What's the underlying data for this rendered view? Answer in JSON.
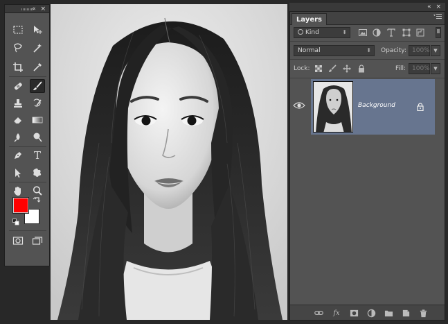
{
  "tools_panel": {
    "collapse_glyph": "«",
    "close_glyph": "×",
    "tools": [
      {
        "name": "rectangular-marquee-tool",
        "icon": "marquee-icon"
      },
      {
        "name": "move-tool",
        "icon": "move-icon"
      },
      {
        "name": "lasso-tool",
        "icon": "lasso-icon"
      },
      {
        "name": "magic-wand-tool",
        "icon": "magic-wand-icon"
      },
      {
        "name": "crop-tool",
        "icon": "crop-icon"
      },
      {
        "name": "eyedropper-tool",
        "icon": "eyedropper-icon"
      },
      {
        "name": "spot-healing-tool",
        "icon": "bandage-icon"
      },
      {
        "name": "brush-tool",
        "icon": "brush-icon",
        "active": true
      },
      {
        "name": "clone-stamp-tool",
        "icon": "stamp-icon"
      },
      {
        "name": "history-brush-tool",
        "icon": "history-brush-icon"
      },
      {
        "name": "eraser-tool",
        "icon": "eraser-icon"
      },
      {
        "name": "gradient-tool",
        "icon": "gradient-icon"
      },
      {
        "name": "blur-tool",
        "icon": "blur-icon"
      },
      {
        "name": "dodge-tool",
        "icon": "dodge-icon"
      },
      {
        "name": "pen-tool",
        "icon": "pen-icon"
      },
      {
        "name": "type-tool",
        "icon": "type-icon",
        "glyph": "T"
      },
      {
        "name": "path-selection-tool",
        "icon": "arrow-icon"
      },
      {
        "name": "custom-shape-tool",
        "icon": "shape-icon"
      },
      {
        "name": "hand-tool",
        "icon": "hand-icon"
      },
      {
        "name": "zoom-tool",
        "icon": "zoom-icon"
      }
    ],
    "foreground_color": "#ff0000",
    "background_color": "#ffffff"
  },
  "layers_panel": {
    "collapse_glyph": "«",
    "close_glyph": "×",
    "tab_label": "Layers",
    "filter_kind_label": "Kind",
    "blend_mode": "Normal",
    "opacity_label": "Opacity:",
    "opacity_value": "100%",
    "lock_label": "Lock:",
    "fill_label": "Fill:",
    "fill_value": "100%",
    "layers": [
      {
        "name": "Background",
        "visible": true,
        "locked": true,
        "selected": true
      }
    ],
    "selected_color": "#67758f",
    "fx_label": "fx"
  }
}
